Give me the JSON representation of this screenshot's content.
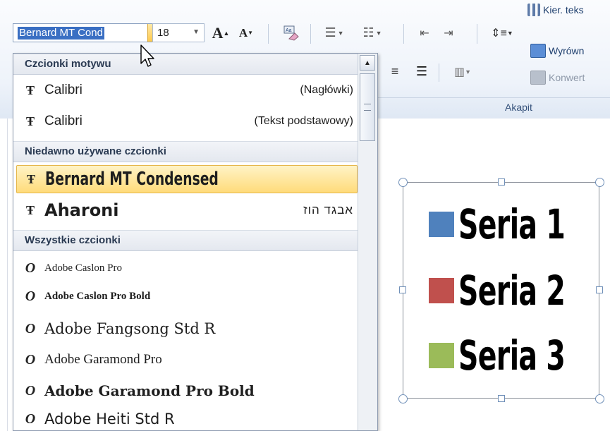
{
  "ribbon": {
    "font_name_value": "Bernard MT Cond",
    "font_size_value": "18",
    "grow_font_label": "A",
    "shrink_font_label": "A",
    "text_direction_label": "Kier. teks",
    "align_text_label": "Wyrówn",
    "convert_label": "Konwert",
    "paragraph_group_label": "Akapit"
  },
  "font_dropdown": {
    "sections": [
      {
        "header": "Czcionki motywu",
        "items": [
          {
            "name": "Calibri",
            "hint": "(Nagłówki)"
          },
          {
            "name": "Calibri",
            "hint": "(Tekst podstawowy)"
          }
        ]
      },
      {
        "header": "Niedawno używane czcionki",
        "items": [
          {
            "name": "Bernard MT Condensed",
            "hint": "",
            "selected": true
          },
          {
            "name": "Aharoni",
            "hint": "אבגד הוז"
          }
        ]
      },
      {
        "header": "Wszystkie czcionki",
        "items": [
          {
            "name": "Adobe Caslon Pro",
            "hint": ""
          },
          {
            "name": "Adobe Caslon Pro Bold",
            "hint": ""
          },
          {
            "name": "Adobe Fangsong Std R",
            "hint": ""
          },
          {
            "name": "Adobe Garamond Pro",
            "hint": ""
          },
          {
            "name": "Adobe Garamond Pro Bold",
            "hint": ""
          },
          {
            "name": "Adobe Heiti Std R",
            "hint": ""
          }
        ]
      }
    ],
    "font_icon_truetype": "Ŧ",
    "font_icon_opentype": "O"
  },
  "legend": {
    "items": [
      {
        "label": "Seria 1",
        "color": "#4f81bd"
      },
      {
        "label": "Seria 2",
        "color": "#c0504d"
      },
      {
        "label": "Seria 3",
        "color": "#9bbb59"
      }
    ]
  },
  "colors": {
    "selection_highlight": "#3a6fc3",
    "selected_item": "#ffdb7a"
  }
}
